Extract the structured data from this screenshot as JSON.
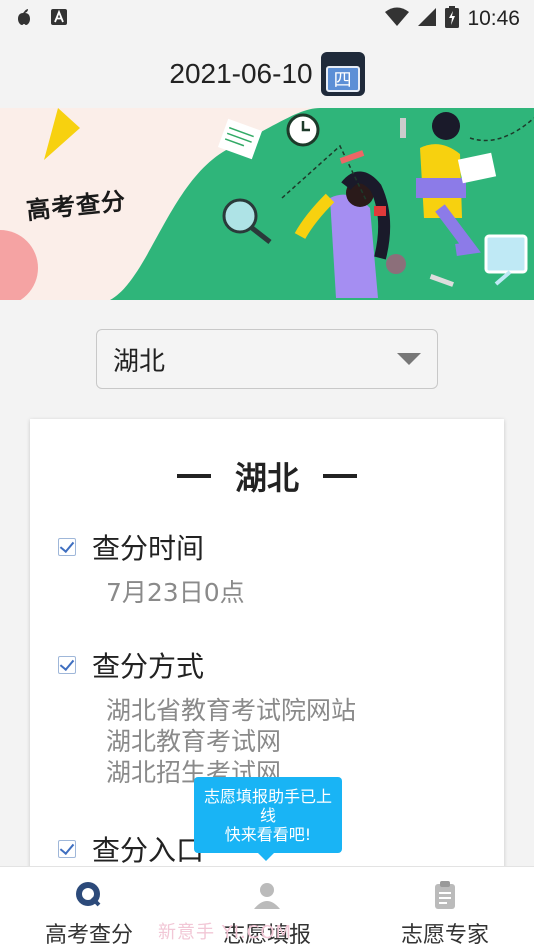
{
  "status_bar": {
    "time": "10:46"
  },
  "date_header": {
    "date": "2021-06-10",
    "weekday": "四"
  },
  "banner": {
    "title": "高考查分"
  },
  "province_select": {
    "value": "湖北"
  },
  "card": {
    "title": "湖北",
    "sections": [
      {
        "title": "查分时间",
        "lines": [
          "7月23日0点"
        ]
      },
      {
        "title": "查分方式",
        "lines": [
          "湖北省教育考试院网站",
          "湖北教育考试网",
          "湖北招生考试网"
        ]
      },
      {
        "title": "查分入口",
        "lines": []
      }
    ]
  },
  "tooltip": {
    "line1": "志愿填报助手已上",
    "line2": "线",
    "line3": "快来看看吧!"
  },
  "bottom_nav": {
    "items": [
      {
        "label": "高考查分",
        "icon": "search-chat-icon"
      },
      {
        "label": "志愿填报",
        "icon": "person-icon"
      },
      {
        "label": "志愿专家",
        "icon": "clipboard-icon"
      }
    ]
  },
  "watermark": "新意手 YI.COM",
  "colors": {
    "banner_green": "#2fb57a",
    "tooltip_blue": "#19b4f5",
    "accent_blue": "#3f6fc0"
  }
}
